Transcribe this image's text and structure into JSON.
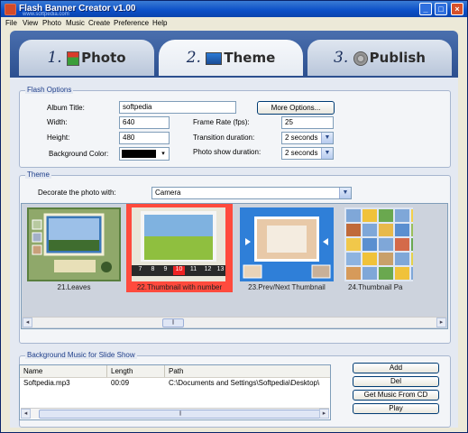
{
  "window": {
    "title": "Flash Banner Creator v1.00",
    "watermark": "www.softpedia.com"
  },
  "menu": [
    "File",
    "View",
    "Photo",
    "Music",
    "Create",
    "Preference",
    "Help"
  ],
  "steps": [
    {
      "num": "1.",
      "label": "Photo",
      "active": false
    },
    {
      "num": "2.",
      "label": "Theme",
      "active": true
    },
    {
      "num": "3.",
      "label": "Publish",
      "active": false
    }
  ],
  "flash_options": {
    "legend": "Flash Options",
    "album_title_label": "Album Title:",
    "album_title_value": "softpedia",
    "width_label": "Width:",
    "width_value": "640",
    "height_label": "Height:",
    "height_value": "480",
    "bg_color_label": "Background Color:",
    "bg_color": "#000000",
    "more_options": "More Options...",
    "frame_rate_label": "Frame Rate (fps):",
    "frame_rate_value": "25",
    "transition_label": "Transition duration:",
    "transition_value": "2 seconds",
    "photo_show_label": "Photo show duration:",
    "photo_show_value": "2 seconds"
  },
  "theme": {
    "legend": "Theme",
    "decorate_label": "Decorate the photo with:",
    "decorate_value": "Camera",
    "items": [
      {
        "caption": "21.Leaves",
        "selected": false
      },
      {
        "caption": "22.Thumbnail with number",
        "selected": true
      },
      {
        "caption": "23.Prev/Next Thumbnail",
        "selected": false
      },
      {
        "caption": "24.Thumbnail Pa",
        "selected": false
      }
    ],
    "strip_numbers": [
      "7",
      "8",
      "9",
      "10",
      "11",
      "12",
      "13"
    ],
    "strip_selected": "10",
    "selected_color": "#ff4a3d"
  },
  "music": {
    "legend": "Background Music for Slide Show",
    "columns": [
      "Name",
      "Length",
      "Path"
    ],
    "rows": [
      {
        "name": "Softpedia.mp3",
        "length": "00:09",
        "path": "C:\\Documents and Settings\\Softpedia\\Desktop\\"
      }
    ],
    "buttons": {
      "add": "Add",
      "del": "Del",
      "get_cd": "Get Music From CD",
      "play": "Play"
    }
  }
}
